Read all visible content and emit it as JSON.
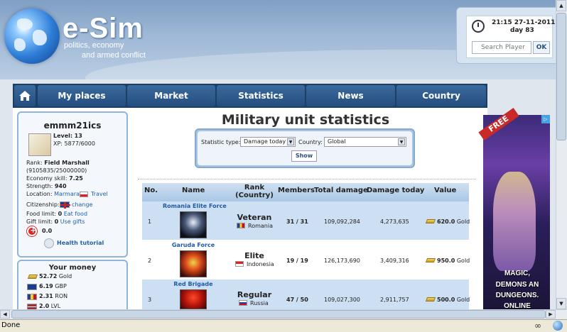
{
  "header": {
    "logo": "e-Sim",
    "tagline1": "politics, economy",
    "tagline2": "and armed conflict",
    "time": "21:15 27-11-2011",
    "day": "day 83",
    "search_placeholder": "Search Player",
    "search_button": "OK"
  },
  "nav": {
    "items": [
      {
        "label": "My places"
      },
      {
        "label": "Market"
      },
      {
        "label": "Statistics"
      },
      {
        "label": "News"
      },
      {
        "label": "Country"
      }
    ]
  },
  "profile": {
    "username": "emmm21ics",
    "level_label": "Level:",
    "level": "13",
    "xp_label": "XP:",
    "xp": "5877/6000",
    "rank_label": "Rank:",
    "rank": "Field Marshall",
    "rank_points": "(9105835/25000000)",
    "economy_label": "Economy skill:",
    "economy": "7.25",
    "strength_label": "Strength:",
    "strength": "940",
    "location_label": "Location:",
    "location": "Marmara",
    "travel": "Travel",
    "citizenship_label": "Citizenship:",
    "citizenship_change": "change",
    "food_label": "Food limit:",
    "food": "0",
    "food_link": "Eat food",
    "gift_label": "Gift limit:",
    "gift": "0",
    "gift_link": "Use gifts",
    "health": "0.0",
    "health_tutorial": "Health tutorial"
  },
  "money": {
    "title": "Your money",
    "items": [
      {
        "value": "52.72",
        "unit": "Gold"
      },
      {
        "value": "6.19",
        "unit": "GBP"
      },
      {
        "value": "2.31",
        "unit": "RON"
      },
      {
        "value": "2.0",
        "unit": "LVL"
      }
    ]
  },
  "main": {
    "title": "Military unit statistics",
    "filter": {
      "stat_label": "Statistic type:",
      "stat_value": "Damage today",
      "country_label": "Country:",
      "country_value": "Global",
      "show": "Show"
    },
    "table": {
      "headers": {
        "no": "No.",
        "name": "Name",
        "rank1": "Rank",
        "rank2": "(Country)",
        "members": "Members",
        "total": "Total damage",
        "today": "Damage today",
        "value": "Value"
      },
      "rows": [
        {
          "no": "1",
          "name": "Romania Elite Force",
          "rank": "Veteran",
          "country": "Romania",
          "members_cur": "31",
          "members_max": "31",
          "total": "109,092,284",
          "today": "4,273,635",
          "value": "620.0",
          "value_unit": "Gold"
        },
        {
          "no": "2",
          "name": "Garuda Force",
          "rank": "Elite",
          "country": "Indonesia",
          "members_cur": "19",
          "members_max": "19",
          "total": "126,173,690",
          "today": "3,409,316",
          "value": "950.0",
          "value_unit": "Gold"
        },
        {
          "no": "3",
          "name": "Red Brigade",
          "rank": "Regular",
          "country": "Russia",
          "members_cur": "47",
          "members_max": "50",
          "total": "109,027,300",
          "today": "2,911,757",
          "value": "500.0",
          "value_unit": "Gold"
        }
      ]
    }
  },
  "ad": {
    "banner": "FREE",
    "line1": "MAGIC,",
    "line2": "DEMONS AN",
    "line3": "DUNGEONS.",
    "line4": "ONLINE"
  },
  "status": {
    "text": "Done"
  }
}
